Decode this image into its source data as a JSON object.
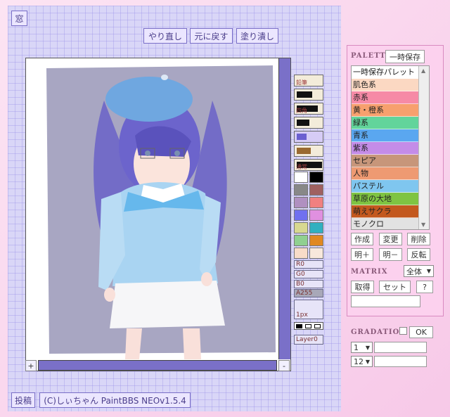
{
  "window_button": "窓",
  "toolbar": {
    "redo": "やり直し",
    "undo": "元に戻す",
    "fill": "塗り潰し"
  },
  "canvas": {
    "scroll_plus": "+",
    "scroll_minus": "-",
    "artwork": "girl-in-blue-beret-illustration"
  },
  "tools": {
    "labels": [
      "鉛筆",
      "",
      "四角",
      "",
      "",
      "",
      "通常"
    ]
  },
  "swatches": [
    "#ffffff",
    "#000000",
    "#888888",
    "#a06060",
    "#b090c0",
    "#f08080",
    "#7070f0",
    "#e090e0",
    "#d8d890",
    "#30b0c0",
    "#90d090",
    "#e08820",
    "#f8dcc8",
    "#f8e8dc"
  ],
  "rgba": {
    "r": "R0",
    "g": "G0",
    "b": "B0",
    "a": "A255"
  },
  "pen_size": "1px",
  "layer": "Layer0",
  "footer": {
    "post_button": "投稿",
    "credit": "(C)しぃちゃん PaintBBS NEOv1.5.4"
  },
  "palette": {
    "title": "PALETTE",
    "temp_save_button": "一時保存",
    "items": [
      {
        "label": "一時保存パレット",
        "color": "#ffffff"
      },
      {
        "label": "肌色系",
        "color": "#fbd8c2"
      },
      {
        "label": "赤系",
        "color": "#f68aa6"
      },
      {
        "label": "黄・橙系",
        "color": "#f7a06e"
      },
      {
        "label": "緑系",
        "color": "#62d49b"
      },
      {
        "label": "青系",
        "color": "#5aa7f0"
      },
      {
        "label": "紫系",
        "color": "#c48ce8"
      },
      {
        "label": "セピア",
        "color": "#c7967a"
      },
      {
        "label": "人物",
        "color": "#ee9a72"
      },
      {
        "label": "パステル",
        "color": "#7fc6ef"
      },
      {
        "label": "草原の大地",
        "color": "#7fc442"
      },
      {
        "label": "萌えサクラ",
        "color": "#c3581e"
      },
      {
        "label": "モノクロ",
        "color": "#e2e2e2"
      }
    ],
    "buttons": {
      "create": "作成",
      "change": "変更",
      "delete": "削除",
      "lighter": "明＋",
      "darker": "明－",
      "invert": "反転"
    }
  },
  "matrix": {
    "title": "MATRIX",
    "scope": "全体",
    "get": "取得",
    "set": "セット",
    "help": "?"
  },
  "gradation": {
    "title": "GRADATION",
    "ok": "OK",
    "step1": "1",
    "step2": "12"
  }
}
